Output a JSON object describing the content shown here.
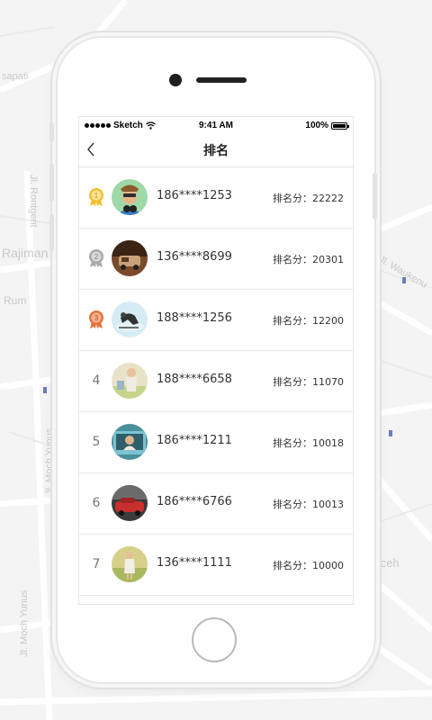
{
  "status_bar": {
    "carrier": "Sketch",
    "time": "9:41 AM",
    "battery": "100%"
  },
  "nav": {
    "title": "排名"
  },
  "rankings": [
    {
      "rank": "1",
      "medal": "gold",
      "phone": "186****1253",
      "score_label": "排名分：",
      "score": "22222"
    },
    {
      "rank": "2",
      "medal": "silver",
      "phone": "136****8699",
      "score_label": "排名分：",
      "score": "20301"
    },
    {
      "rank": "3",
      "medal": "bronze",
      "phone": "188****1256",
      "score_label": "排名分：",
      "score": "12200"
    },
    {
      "rank": "4",
      "medal": "",
      "phone": "188****6658",
      "score_label": "排名分：",
      "score": "11070"
    },
    {
      "rank": "5",
      "medal": "",
      "phone": "186****1211",
      "score_label": "排名分：",
      "score": "10018"
    },
    {
      "rank": "6",
      "medal": "",
      "phone": "186****6766",
      "score_label": "排名分：",
      "score": "10013"
    },
    {
      "rank": "7",
      "medal": "",
      "phone": "136****1111",
      "score_label": "排名分：",
      "score": "10000"
    }
  ],
  "map_labels": {
    "rajiman": "Rajiman",
    "rum": "Rum",
    "rontgent": "Jl. Rontgent",
    "moch_yunus_1": "Jl. Moch Yunus",
    "moch_yunus_2": "Jl. Moch Yunus",
    "aceh": "Aceh",
    "waukenu": "Jl. Waukenu",
    "sapati": "sapati"
  },
  "colors": {
    "gold": "#f2c130",
    "silver": "#a8a8a8",
    "bronze": "#e5733b"
  }
}
